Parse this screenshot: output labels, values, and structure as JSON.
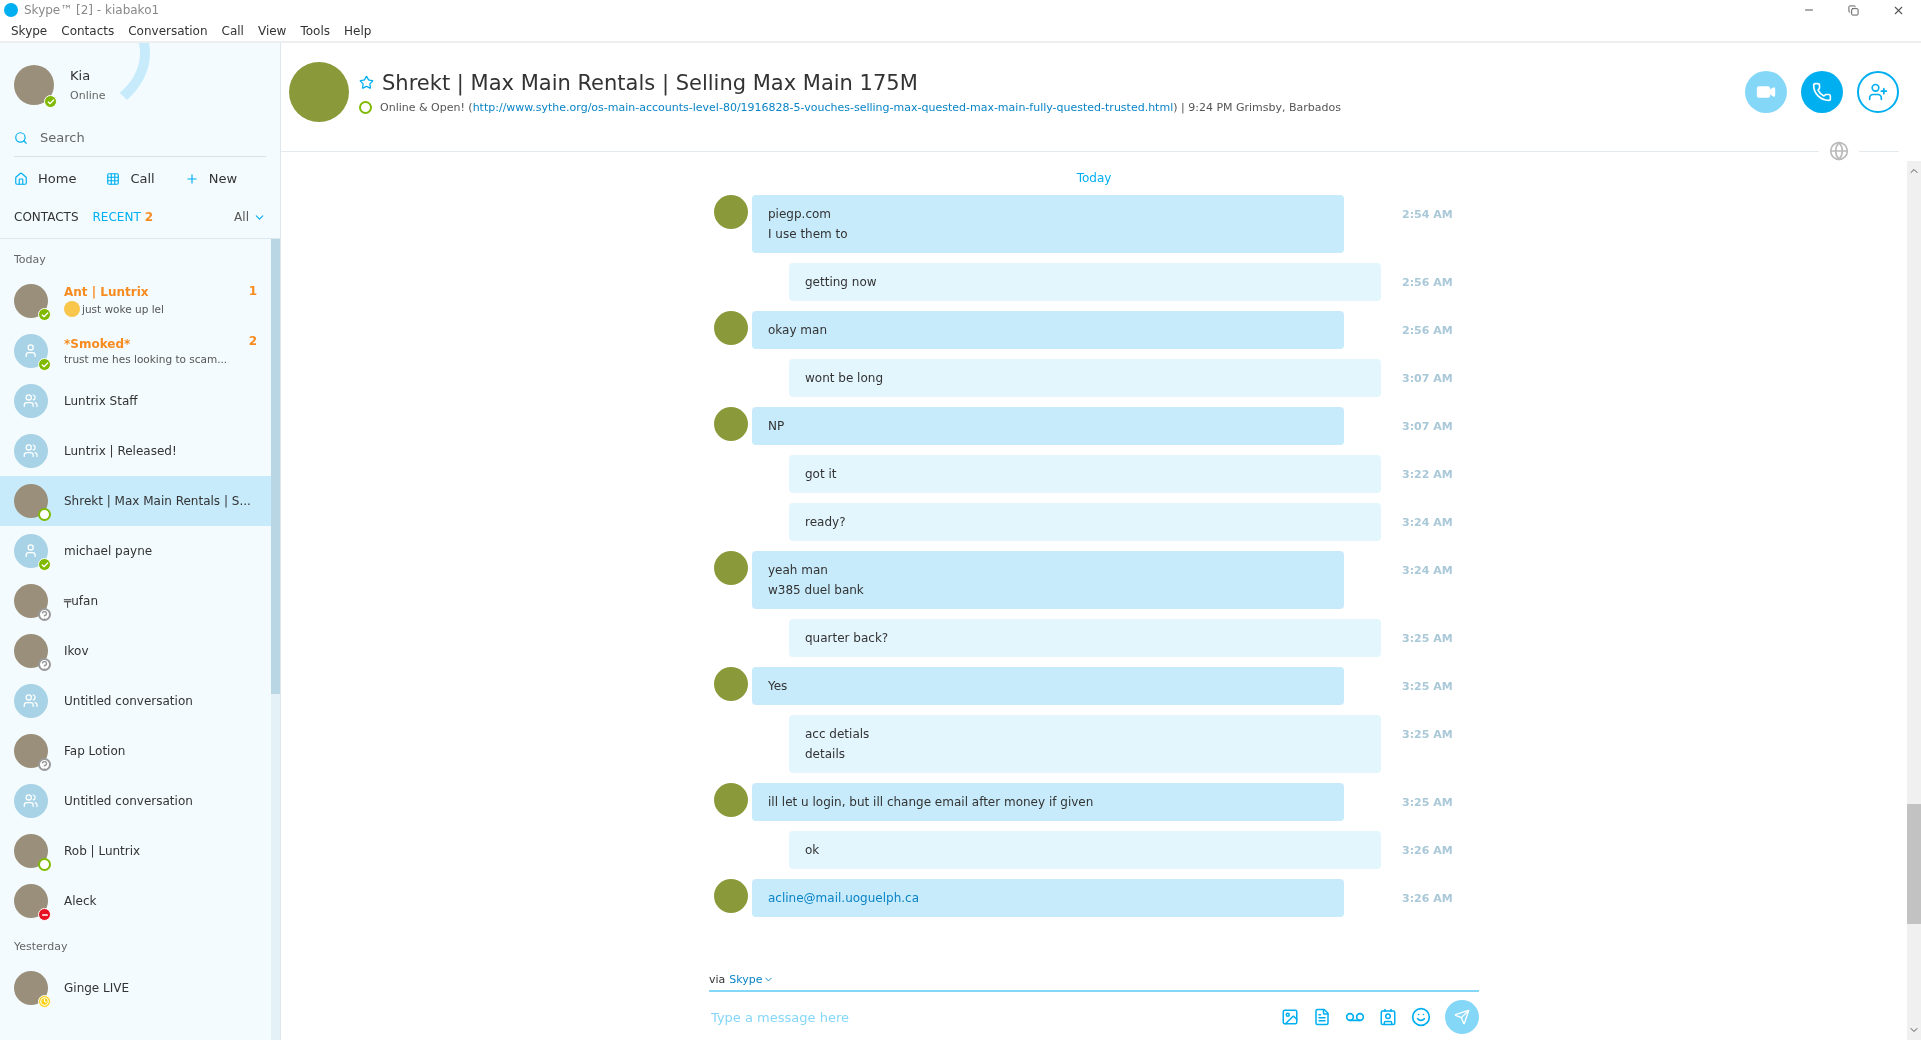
{
  "window": {
    "title": "Skype™ [2] - kiabako1"
  },
  "menu": [
    "Skype",
    "Contacts",
    "Conversation",
    "Call",
    "View",
    "Tools",
    "Help"
  ],
  "profile": {
    "name": "Kia",
    "status_text": "Online",
    "presence": {
      "kind": "online",
      "color": "#7fba00"
    }
  },
  "search": {
    "placeholder": "Search"
  },
  "nav": [
    {
      "kind": "home",
      "label": "Home"
    },
    {
      "kind": "dialpad",
      "label": "Call"
    },
    {
      "kind": "plus",
      "label": "New"
    }
  ],
  "list_tabs": [
    {
      "label": "CONTACTS",
      "selected": false
    },
    {
      "label": "RECENT",
      "selected": true,
      "count": "2"
    }
  ],
  "filter": "All",
  "sections": [
    {
      "label": "Today",
      "contacts": [
        {
          "name": "Ant | Luntrix",
          "preview": "just woke up lel",
          "emoji": true,
          "unread": "1",
          "kind": "photo",
          "presence": {
            "kind": "online",
            "color": "#7fba00"
          },
          "selected": false
        },
        {
          "name": "*Smoked*",
          "preview": "trust me hes looking to scam...",
          "emoji": false,
          "unread": "2",
          "kind": "person",
          "presence": {
            "kind": "online",
            "color": "#7fba00"
          },
          "selected": false
        },
        {
          "name": "Luntrix Staff",
          "kind": "group",
          "selected": false
        },
        {
          "name": "Luntrix | Released!",
          "kind": "group",
          "selected": false
        },
        {
          "name": "Shrekt | Max Main Rentals | S...",
          "kind": "photo",
          "presence": {
            "kind": "open",
            "color": "#7fba00"
          },
          "selected": true
        },
        {
          "name": "michael payne",
          "kind": "person",
          "presence": {
            "kind": "online",
            "color": "#7fba00"
          },
          "selected": false
        },
        {
          "name": "╤ufan",
          "kind": "photo",
          "presence": {
            "kind": "unknown",
            "color": "#999999"
          },
          "selected": false
        },
        {
          "name": "Ikov",
          "kind": "photo",
          "presence": {
            "kind": "unknown",
            "color": "#999999"
          },
          "selected": false
        },
        {
          "name": "Untitled conversation",
          "kind": "group",
          "selected": false
        },
        {
          "name": "Fap Lotion",
          "kind": "photo",
          "presence": {
            "kind": "unknown",
            "color": "#999999"
          },
          "selected": false
        },
        {
          "name": "Untitled conversation",
          "kind": "group",
          "selected": false
        },
        {
          "name": "Rob | Luntrix",
          "kind": "photo",
          "presence": {
            "kind": "open",
            "color": "#7fba00"
          },
          "selected": false
        },
        {
          "name": "Aleck",
          "kind": "photo",
          "presence": {
            "kind": "busy",
            "color": "#e81123"
          },
          "selected": false
        }
      ]
    },
    {
      "label": "Yesterday",
      "contacts": [
        {
          "name": "Ginge LIVE",
          "kind": "photo",
          "presence": {
            "kind": "away",
            "color": "#fcd116"
          },
          "selected": false
        }
      ]
    }
  ],
  "conversation": {
    "title": "Shrekt | Max Main Rentals | Selling Max Main 175M",
    "presence": {
      "kind": "open",
      "color": "#7fba00"
    },
    "mood": "Online & Open! (",
    "mood_link": "http://www.sythe.org/os-main-accounts-level-80/1916828-5-vouches-selling-max-quested-max-main-fully-quested-trusted.html",
    "mood_end": ")  |  9:24 PM Grimsby, Barbados",
    "favorite": false
  },
  "day_label": "Today",
  "messages": [
    {
      "kind": "incoming",
      "lines": [
        "piegp.com",
        "I use them to"
      ],
      "time": "2:54 AM",
      "link": false
    },
    {
      "kind": "outgoing",
      "lines": [
        "getting now"
      ],
      "time": "2:56 AM",
      "link": false
    },
    {
      "kind": "incoming",
      "lines": [
        "okay man"
      ],
      "time": "2:56 AM",
      "link": false
    },
    {
      "kind": "outgoing",
      "lines": [
        "wont be long"
      ],
      "time": "3:07 AM",
      "link": false
    },
    {
      "kind": "incoming",
      "lines": [
        "NP"
      ],
      "time": "3:07 AM",
      "link": false
    },
    {
      "kind": "outgoing",
      "lines": [
        "got it"
      ],
      "time": "3:22 AM",
      "link": false
    },
    {
      "kind": "outgoing",
      "lines": [
        "ready?"
      ],
      "time": "3:24 AM",
      "link": false
    },
    {
      "kind": "incoming",
      "lines": [
        "yeah man",
        "w385 duel bank"
      ],
      "time": "3:24 AM",
      "link": false
    },
    {
      "kind": "outgoing",
      "lines": [
        "quarter back?"
      ],
      "time": "3:25 AM",
      "link": false
    },
    {
      "kind": "incoming",
      "lines": [
        "Yes"
      ],
      "time": "3:25 AM",
      "link": false
    },
    {
      "kind": "outgoing",
      "lines": [
        "acc detials",
        "details"
      ],
      "time": "3:25 AM",
      "link": false
    },
    {
      "kind": "incoming",
      "lines": [
        "ill let u login, but ill change email after money if given"
      ],
      "time": "3:25 AM",
      "link": false
    },
    {
      "kind": "outgoing",
      "lines": [
        "ok"
      ],
      "time": "3:26 AM",
      "link": false
    },
    {
      "kind": "incoming",
      "lines": [
        "acline@mail.uoguelph.ca"
      ],
      "time": "3:26 AM",
      "link": true
    }
  ],
  "composer": {
    "via": "via",
    "service": "Skype",
    "placeholder": "Type a message here"
  }
}
